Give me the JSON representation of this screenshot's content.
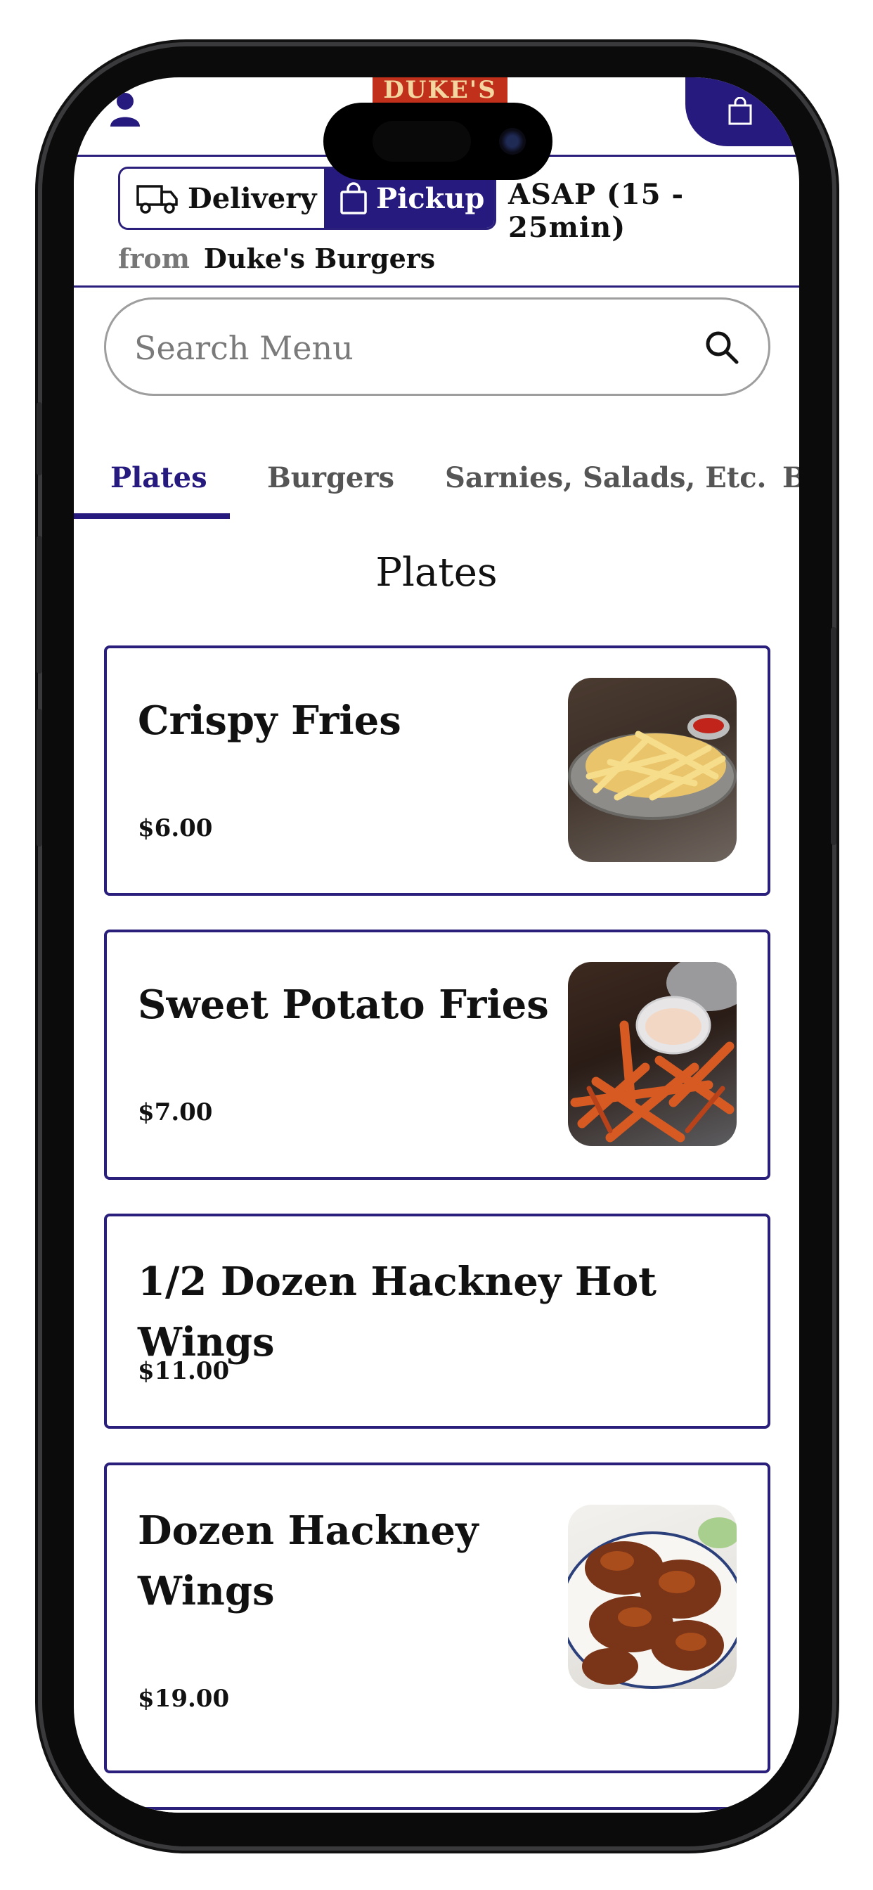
{
  "header": {
    "logo_text": "DUKE'S",
    "cart_label": ""
  },
  "order_mode": {
    "delivery_label": "Delivery",
    "pickup_label": "Pickup",
    "selected": "Pickup",
    "eta": "ASAP (15 - 25min)",
    "from_label": "from",
    "store_name": "Duke's Burgers"
  },
  "search": {
    "placeholder": "Search Menu",
    "value": ""
  },
  "tabs": [
    {
      "label": "Plates",
      "active": true
    },
    {
      "label": "Burgers",
      "active": false
    },
    {
      "label": "Sarnies, Salads, Etc.",
      "active": false
    },
    {
      "label": "B",
      "active": false
    }
  ],
  "section": {
    "title": "Plates"
  },
  "items": [
    {
      "name": "Crispy Fries",
      "price": "$6.00",
      "image": "crispy-fries-photo"
    },
    {
      "name": "Sweet Potato Fries",
      "price": "$7.00",
      "image": "sweet-potato-fries-photo"
    },
    {
      "name": "1/2 Dozen Hackney Hot Wings",
      "price": "$11.00",
      "image": ""
    },
    {
      "name_line1": "Dozen Hackney",
      "name_line2": "Wings",
      "price": "$19.00",
      "image": "hot-wings-photo"
    }
  ],
  "colors": {
    "brand": "#271a7e",
    "logo_red": "#c0301a",
    "border_gray": "#9e9e9e"
  }
}
